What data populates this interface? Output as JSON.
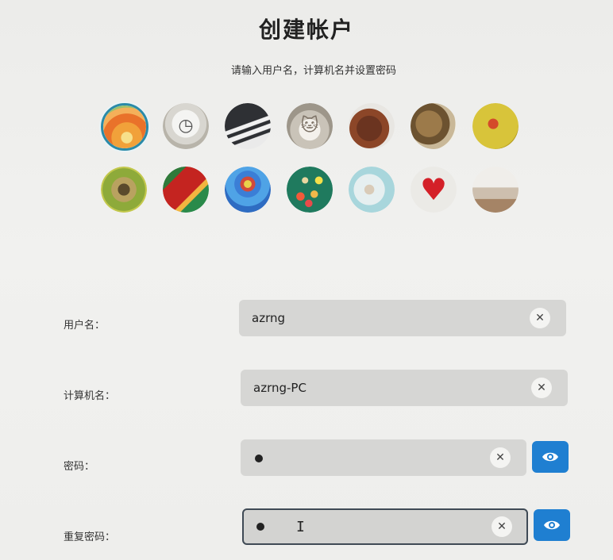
{
  "header": {
    "title": "创建帐户",
    "subtitle": "请输入用户名，计算机名并设置密码"
  },
  "avatars": [
    {
      "icon": "gerbera-flower-avatar",
      "selected": true
    },
    {
      "icon": "clock-avatar",
      "selected": false
    },
    {
      "icon": "piano-keys-avatar",
      "selected": false
    },
    {
      "icon": "kitten-avatar",
      "selected": false
    },
    {
      "icon": "horse-avatar",
      "selected": false
    },
    {
      "icon": "coffee-avatar",
      "selected": false
    },
    {
      "icon": "ladybug-avatar",
      "selected": false
    },
    {
      "icon": "butterfly-avatar",
      "selected": false
    },
    {
      "icon": "parrot-avatar",
      "selected": false
    },
    {
      "icon": "hot-air-balloon-avatar",
      "selected": false
    },
    {
      "icon": "balls-avatar",
      "selected": false
    },
    {
      "icon": "bird-avatar",
      "selected": false
    },
    {
      "icon": "heart-avatar",
      "selected": false
    },
    {
      "icon": "room-avatar",
      "selected": false
    }
  ],
  "form": {
    "username": {
      "label": "用户名：",
      "value": "azrng"
    },
    "computer_name": {
      "label": "计算机名：",
      "value": "azrng-PC"
    },
    "password": {
      "label": "密码：",
      "masked_value": "●"
    },
    "repeat_password": {
      "label": "重复密码：",
      "masked_value": "●"
    }
  },
  "icons": {
    "clear": "close-icon",
    "reveal": "eye-icon"
  },
  "colors": {
    "accent": "#1f7fd1",
    "selected_ring": "#2a8aa8",
    "field_bg": "#d6d6d4"
  }
}
